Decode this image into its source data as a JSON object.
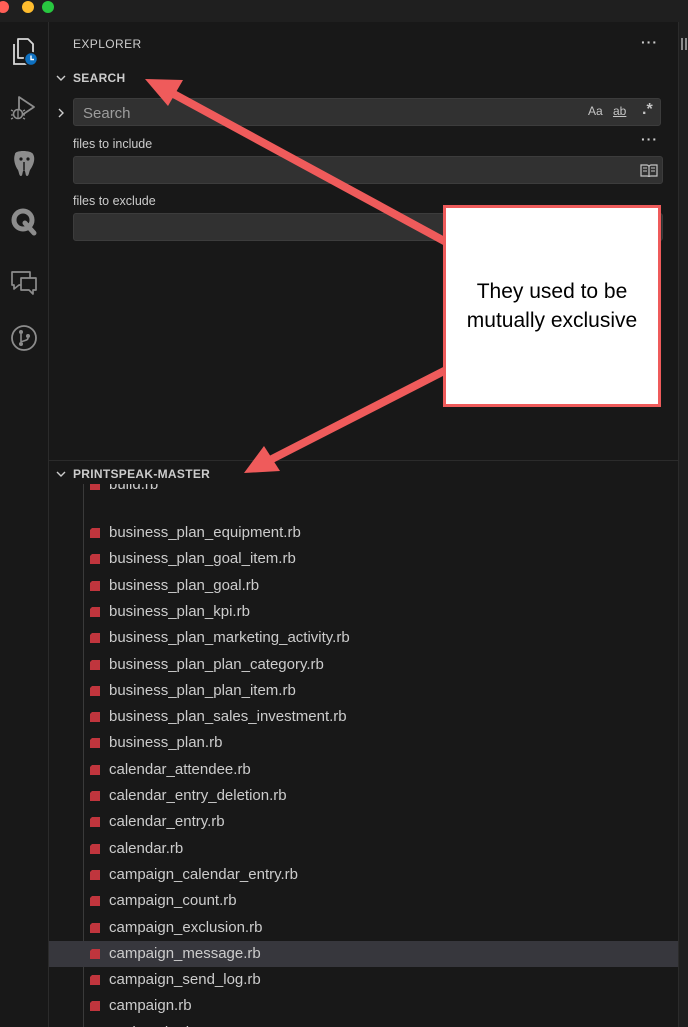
{
  "titlebar": {
    "buttons": [
      {
        "name": "close",
        "color": "#ff5f57"
      },
      {
        "name": "minimize",
        "color": "#febc2e"
      },
      {
        "name": "zoom",
        "color": "#28c840"
      }
    ]
  },
  "activity_bar": {
    "items": [
      {
        "name": "explorer",
        "icon": "files-icon"
      },
      {
        "name": "run-and-debug",
        "icon": "run-debug-icon"
      },
      {
        "name": "postgres",
        "icon": "elephant-icon"
      },
      {
        "name": "extension-q",
        "icon": "q-icon"
      },
      {
        "name": "remote-explorer",
        "icon": "remote-icon"
      },
      {
        "name": "source-control",
        "icon": "git-icon"
      }
    ]
  },
  "sidebar": {
    "title": "EXPLORER",
    "more_label": "···"
  },
  "search_section": {
    "title": "SEARCH",
    "placeholder": "Search",
    "match_case_label": "Aa",
    "whole_word_label": "ab",
    "regex_label": ".*",
    "details_more_label": "···",
    "files_to_include_label": "files to include",
    "files_to_include_value": "",
    "files_to_exclude_label": "files to exclude",
    "files_to_exclude_value": ""
  },
  "folder_section": {
    "title": "PRINTSPEAK-MASTER",
    "partial_item": "build.rb",
    "files": [
      "business_plan_equipment.rb",
      "business_plan_goal_item.rb",
      "business_plan_goal.rb",
      "business_plan_kpi.rb",
      "business_plan_marketing_activity.rb",
      "business_plan_plan_category.rb",
      "business_plan_plan_item.rb",
      "business_plan_sales_investment.rb",
      "business_plan.rb",
      "calendar_attendee.rb",
      "calendar_entry_deletion.rb",
      "calendar_entry.rb",
      "calendar.rb",
      "campaign_calendar_entry.rb",
      "campaign_count.rb",
      "campaign_exclusion.rb",
      "campaign_message.rb",
      "campaign_send_log.rb",
      "campaign.rb",
      "cash_sale.rb"
    ],
    "selected_file": "campaign_message.rb"
  },
  "annotation": {
    "text": "They used to be mutually exclusive",
    "border_color": "#ef5b5b",
    "arrow_color": "#ef5b5b"
  },
  "colors": {
    "ruby_icon": "#c0353d",
    "background": "#181818",
    "selection": "#37373d"
  }
}
